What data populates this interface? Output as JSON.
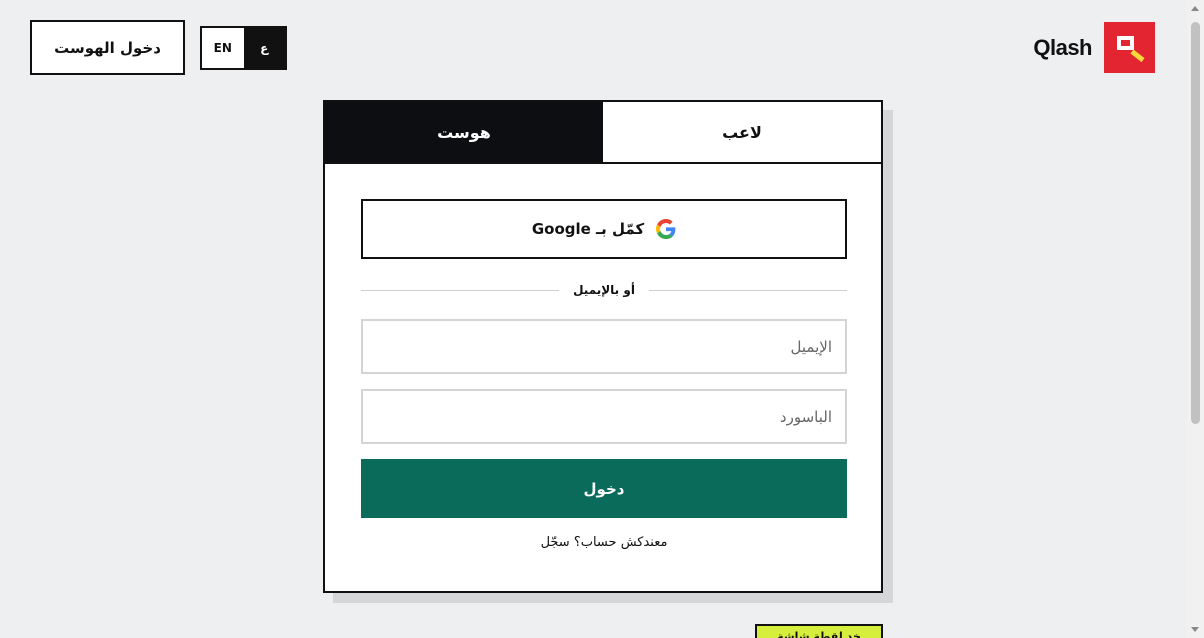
{
  "header": {
    "host_login_label": "دخول الهوست",
    "lang_options": [
      "EN",
      "ع"
    ],
    "active_lang": "ع",
    "brand_name": "Qlash"
  },
  "login_card": {
    "tabs": [
      "هوست",
      "لاعب"
    ],
    "active_tab": "هوست",
    "google_label": "كمّل بـ Google",
    "divider_text": "أو بالإيميل",
    "email_placeholder": "الإيميل",
    "password_placeholder": "الباسورد",
    "submit_label": "دخول",
    "signup_text": "معندكش حساب؟ سجّل"
  },
  "footer_note": "خد لقطة شاشة",
  "colors": {
    "background": "#eeeff1",
    "dark": "#0d0e11",
    "submit_green": "#0a6b5b",
    "brand_red": "#e32431",
    "note_lime": "#d6ef3c"
  },
  "icons": [
    "google-icon",
    "qlash-logo-icon"
  ]
}
